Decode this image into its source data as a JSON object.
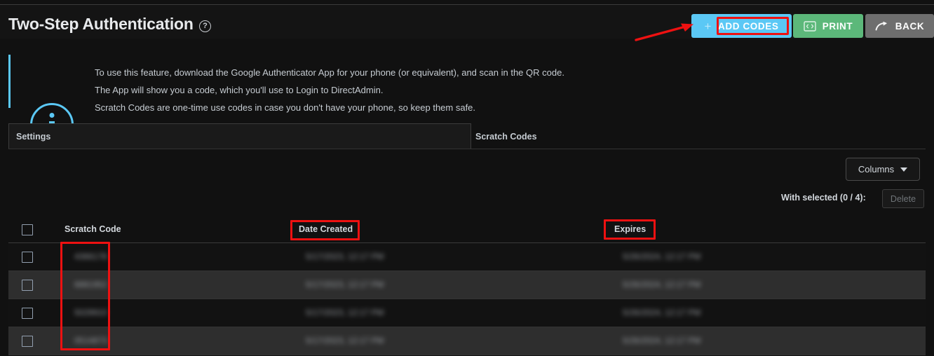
{
  "header": {
    "title": "Two-Step Authentication",
    "help_icon": "question-circle-icon"
  },
  "actions": {
    "add_codes": {
      "label": "ADD CODES",
      "icon": "plus-icon",
      "color": "#5bc8f5"
    },
    "print": {
      "label": "PRINT",
      "icon": "print-code-icon",
      "color": "#5cb87a"
    },
    "back": {
      "label": "BACK",
      "icon": "arrow-back-icon",
      "color": "#6e6e6e"
    }
  },
  "info": {
    "icon": "info-circle-icon",
    "accent_color": "#5bc8f5",
    "lines": [
      "To use this feature, download the Google Authenticator App for your phone (or equivalent), and scan in the QR code.",
      "The App will show you a code, which you'll use to Login to DirectAdmin.",
      "Scratch Codes are one-time use codes in case you don't have your phone, so keep them safe."
    ]
  },
  "tabs": [
    {
      "label": "Settings",
      "active": false
    },
    {
      "label": "Scratch Codes",
      "active": true
    }
  ],
  "toolbar": {
    "columns_label": "Columns",
    "columns_icon": "chevron-down-icon",
    "with_selected_label": "With selected (0 / 4):",
    "delete_label": "Delete",
    "delete_disabled": true
  },
  "table": {
    "columns": [
      "Scratch Code",
      "Date Created",
      "Expires"
    ],
    "select_all_checkbox": "unchecked",
    "rows": [
      {
        "scratch_code": "4366178",
        "date_created": "5/17/2023, 12:17 PM",
        "expires": "5/26/2024, 12:17 PM",
        "selected": false
      },
      {
        "scratch_code": "6881952",
        "date_created": "5/17/2023, 12:17 PM",
        "expires": "5/26/2024, 12:17 PM",
        "selected": false
      },
      {
        "scratch_code": "5029910",
        "date_created": "5/17/2023, 12:17 PM",
        "expires": "5/26/2024, 12:17 PM",
        "selected": false
      },
      {
        "scratch_code": "0514873",
        "date_created": "5/17/2023, 12:17 PM",
        "expires": "5/26/2024, 12:17 PM",
        "selected": false
      }
    ]
  },
  "annotations": {
    "arrow_color": "#ee1111",
    "box_color": "#ee1111",
    "targets": [
      "add-codes-button",
      "date-created-header",
      "expires-header",
      "scratch-code-column"
    ]
  }
}
